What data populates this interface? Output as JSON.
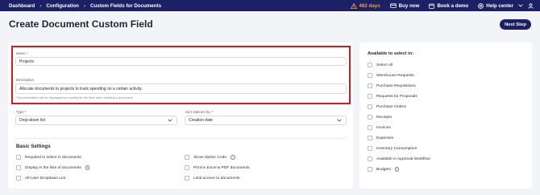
{
  "nav": {
    "breadcrumb": [
      "Dashboard",
      "Configuration",
      "Custom Fields for Documents"
    ],
    "trial_days": "462 days",
    "buy_now": "Buy now",
    "book_demo": "Book a demo",
    "help_center": "Help center"
  },
  "page": {
    "title": "Create Document Custom Field",
    "next_step": "Next Step"
  },
  "form": {
    "name_label": "Name *",
    "name_value": "Projects",
    "description_label": "Description",
    "description_value": "Allocate documents to projects to track spending on a certain activity.",
    "description_hint": "This information will be displayed as a tooltip for the field when creating a document.",
    "type_label": "Type *",
    "type_value": "Drop-down list",
    "sort_label": "Sort Options by: *",
    "sort_value": "Creation date"
  },
  "basic_settings": {
    "title": "Basic Settings",
    "left": [
      {
        "label": "Required to select in documents",
        "info": false
      },
      {
        "label": "Display in the lists of documents",
        "info": true
      },
      {
        "label": "All-User Dropdown List",
        "info": false
      }
    ],
    "right": [
      {
        "label": "Show Option Code",
        "info": true
      },
      {
        "label": "Print in Excel & PDF documents",
        "info": false
      },
      {
        "label": "Limit access to documents",
        "info": false
      }
    ]
  },
  "available": {
    "title": "Available to select in:",
    "items": [
      {
        "label": "Select All",
        "info": false
      },
      {
        "label": "Warehouse Requests",
        "info": false
      },
      {
        "label": "Purchase Requisitions",
        "info": false
      },
      {
        "label": "Requests for Proposals",
        "info": false
      },
      {
        "label": "Purchase Orders",
        "info": false
      },
      {
        "label": "Receipts",
        "info": false
      },
      {
        "label": "Invoices",
        "info": false
      },
      {
        "label": "Expenses",
        "info": false
      },
      {
        "label": "Inventory Consumption",
        "info": false
      },
      {
        "label": "Available in Approval Workflow",
        "info": false
      },
      {
        "label": "Budgets",
        "info": true
      }
    ]
  },
  "colors": {
    "nav_bg": "#1c2166",
    "trial": "#f0a32a",
    "highlight": "#d8191f"
  }
}
